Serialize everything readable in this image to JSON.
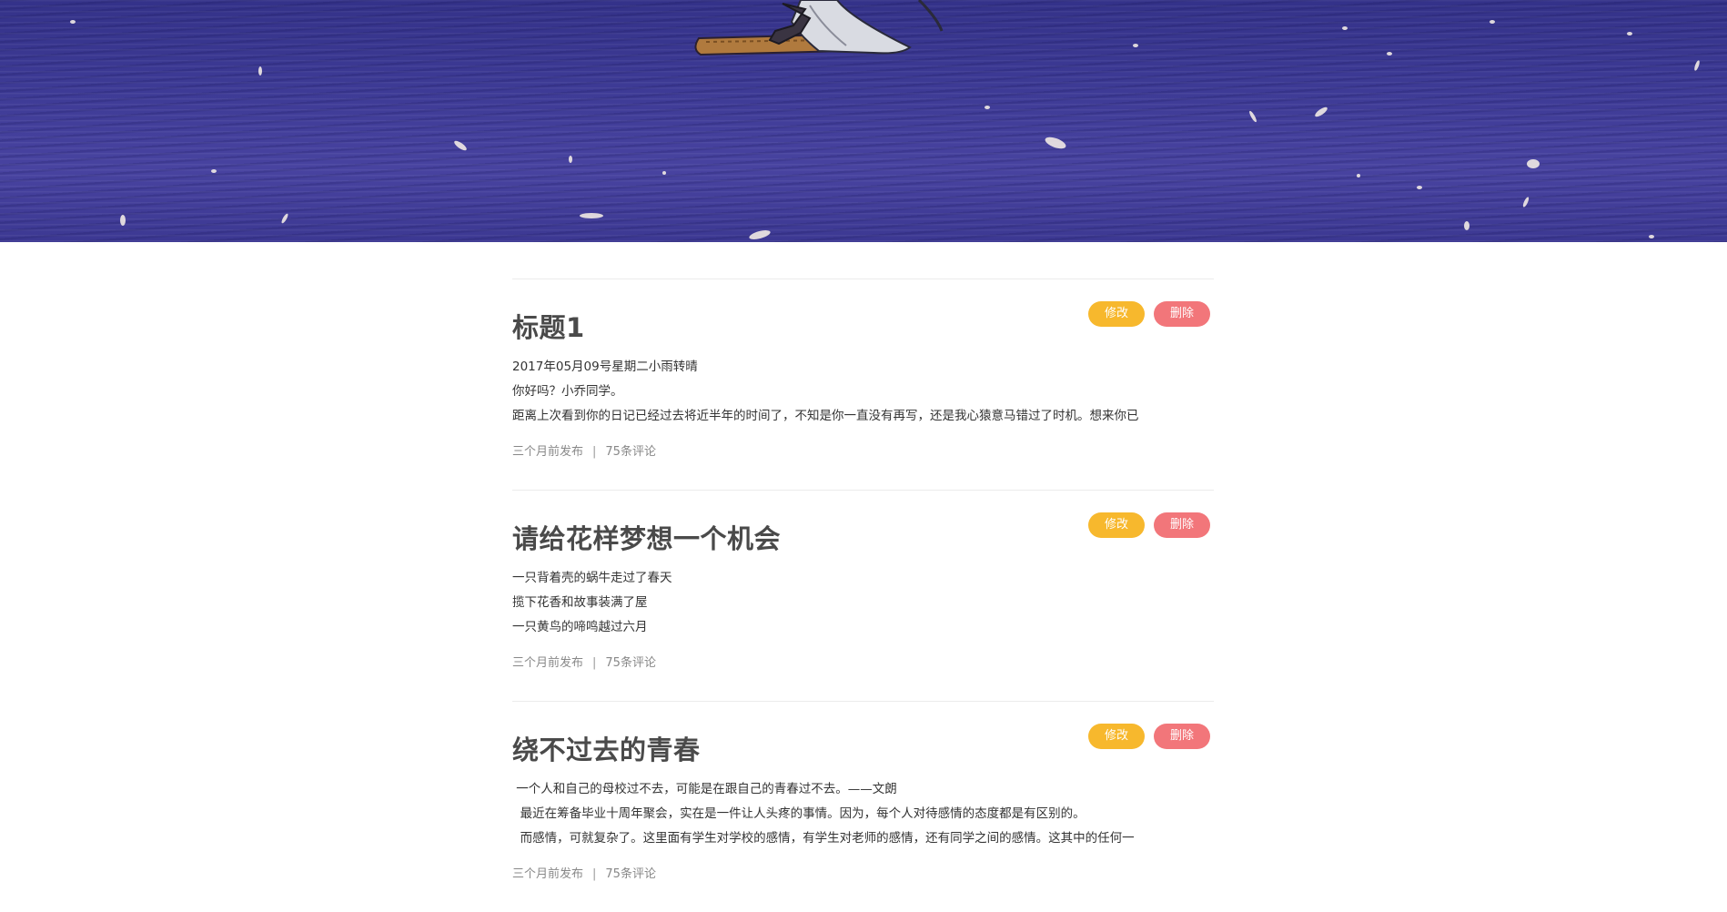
{
  "posts": [
    {
      "title": "标题1",
      "edit_label": "修改",
      "delete_label": "删除",
      "lines": [
        "2017年05月09号星期二小雨转晴",
        "你好吗？小乔同学。",
        "距离上次看到你的日记已经过去将近半年的时间了，不知是你一直没有再写，还是我心猿意马错过了时机。想来你已"
      ],
      "published": "三个月前发布",
      "separator": "|",
      "comments": "75条评论"
    },
    {
      "title": "请给花样梦想一个机会",
      "edit_label": "修改",
      "delete_label": "删除",
      "lines": [
        "一只背着壳的蜗牛走过了春天",
        "揽下花香和故事装满了屋",
        "一只黄鸟的啼鸣越过六月"
      ],
      "published": "三个月前发布",
      "separator": "|",
      "comments": "75条评论"
    },
    {
      "title": "绕不过去的青春",
      "edit_label": "修改",
      "delete_label": "删除",
      "lines": [
        " 一个人和自己的母校过不去，可能是在跟自己的青春过不去。——文朗",
        "  最近在筹备毕业十周年聚会，实在是一件让人头疼的事情。因为，每个人对待感情的态度都是有区别的。",
        "  而感情，可就复杂了。这里面有学生对学校的感情，有学生对老师的感情，还有同学之间的感情。这其中的任何一"
      ],
      "published": "三个月前发布",
      "separator": "|",
      "comments": "75条评论"
    }
  ]
}
